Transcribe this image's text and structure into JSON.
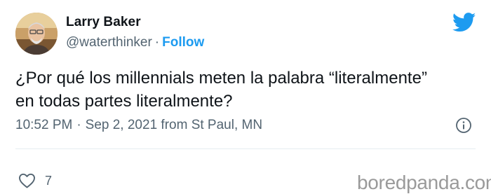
{
  "author": {
    "name": "Larry Baker",
    "handle": "@waterthinker",
    "separator": "·",
    "follow_label": "Follow"
  },
  "tweet": {
    "text_line1": "¿Por qué los millennials meten la palabra “literalmente”",
    "text_line2": "en todas partes literalmente?",
    "time": "10:52 PM",
    "date": "Sep 2, 2021 from St Paul, MN",
    "separator": "·"
  },
  "actions": {
    "likes": "7"
  },
  "icons": {
    "brand": "twitter-bird-icon",
    "info": "info-icon",
    "like": "heart-icon"
  },
  "colors": {
    "twitter_blue": "#1d9bf0",
    "secondary_text": "#536471",
    "primary_text": "#0f1419"
  },
  "watermark": "boredpanda.com"
}
